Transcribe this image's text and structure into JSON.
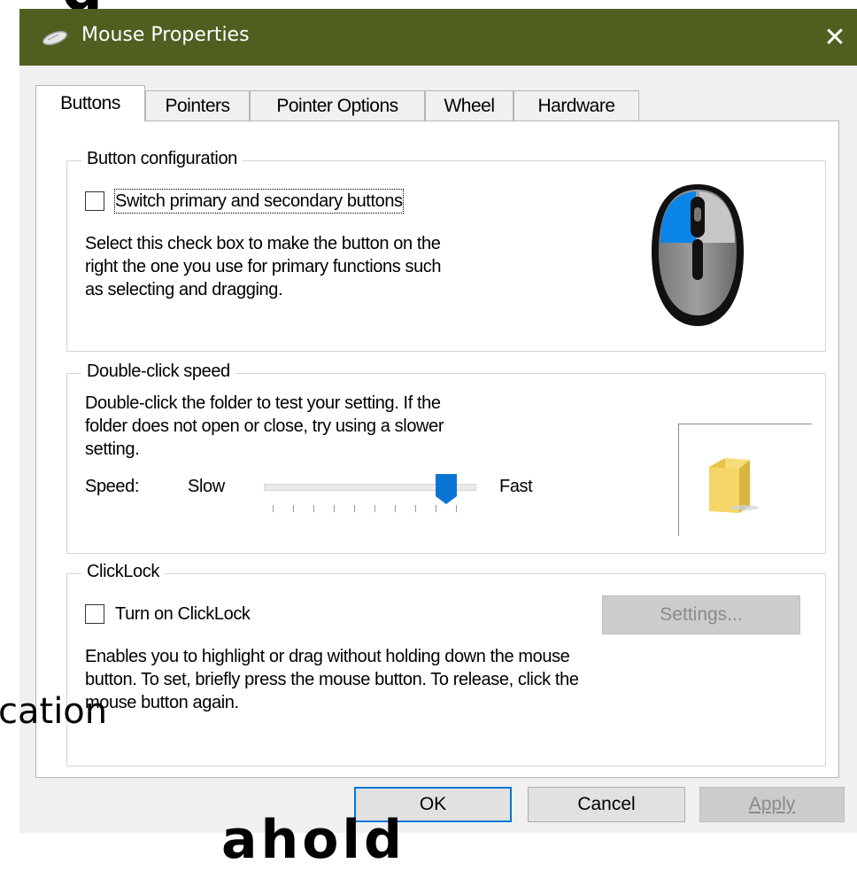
{
  "background": {
    "top_text": "g",
    "left_text": "cation",
    "bottom_text": "ahold"
  },
  "window": {
    "title": "Mouse Properties",
    "close_glyph": "✕"
  },
  "tabs": [
    {
      "label": "Buttons",
      "active": true
    },
    {
      "label": "Pointers",
      "active": false
    },
    {
      "label": "Pointer Options",
      "active": false
    },
    {
      "label": "Wheel",
      "active": false
    },
    {
      "label": "Hardware",
      "active": false
    }
  ],
  "button_config": {
    "group_label": "Button configuration",
    "checkbox_label": "Switch primary and secondary buttons",
    "checked": false,
    "description_lines": [
      "Select this check box to make the button on the",
      "right the one you use for primary functions such",
      "as selecting and dragging."
    ]
  },
  "double_click": {
    "group_label": "Double-click speed",
    "description_lines": [
      "Double-click the folder to test your setting. If the",
      "folder does not open or close, try using a slower",
      "setting."
    ],
    "speed_label": "Speed:",
    "slow_label": "Slow",
    "fast_label": "Fast",
    "speed_value": 0.9
  },
  "clicklock": {
    "group_label": "ClickLock",
    "checkbox_label": "Turn on ClickLock",
    "checked": false,
    "settings_label": "Settings...",
    "description_lines": [
      "Enables you to highlight or drag without holding down the mouse",
      "button. To set, briefly press the mouse button. To release, click the",
      "mouse button again."
    ]
  },
  "footer": {
    "ok_label": "OK",
    "cancel_label": "Cancel",
    "apply_label": "Apply"
  },
  "colors": {
    "titlebar": "#4f5f1f",
    "accent": "#0078d7",
    "mouse_highlight": "#0a84e6"
  }
}
